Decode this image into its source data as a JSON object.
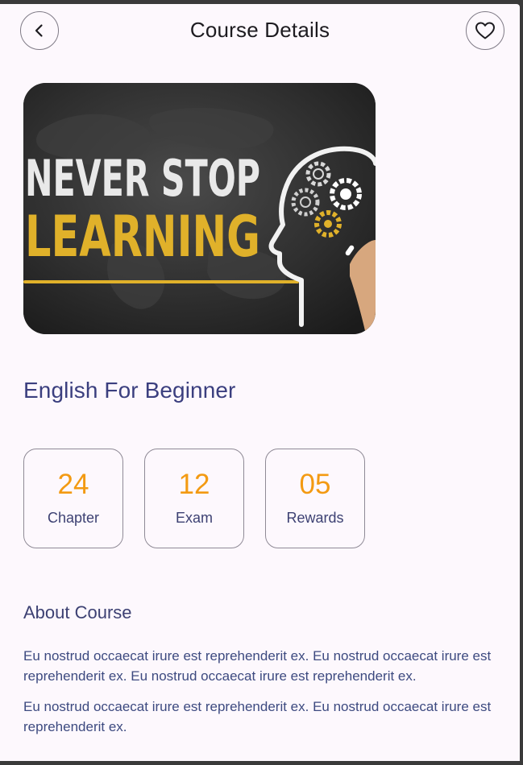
{
  "header": {
    "title": "Course Details",
    "back_icon": "chevron-left-icon",
    "favorite_icon": "heart-outline-icon"
  },
  "hero": {
    "line1": "NEVER STOP",
    "line2": "LEARNING"
  },
  "course": {
    "title": "English For Beginner"
  },
  "stats": [
    {
      "value": "24",
      "label": "Chapter"
    },
    {
      "value": "12",
      "label": "Exam"
    },
    {
      "value": "05",
      "label": "Rewards"
    }
  ],
  "about": {
    "title": "About Course",
    "paragraphs": [
      "Eu nostrud occaecat irure est reprehenderit ex. Eu nostrud occaecat irure est reprehenderit ex. Eu nostrud occaecat irure est reprehenderit ex.",
      "Eu nostrud occaecat irure est reprehenderit ex. Eu nostrud occaecat irure est reprehenderit ex."
    ]
  },
  "colors": {
    "accent": "#f39a12",
    "primary_text": "#3b3f7f",
    "background": "#fdf8fd"
  }
}
